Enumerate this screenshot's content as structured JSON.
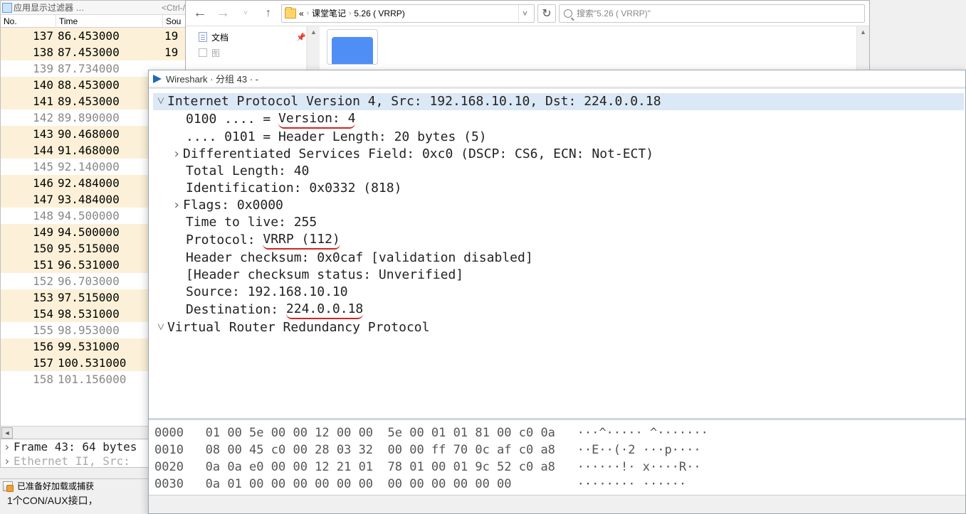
{
  "filter": {
    "label": "应用显示过滤器 …",
    "hint": "<Ctrl-/>"
  },
  "columns": {
    "no": "No.",
    "time": "Time",
    "src": "Sou"
  },
  "packets": [
    {
      "no": "137",
      "time": "86.453000",
      "src": "19",
      "alt": true
    },
    {
      "no": "138",
      "time": "87.453000",
      "src": "19",
      "alt": true
    },
    {
      "no": "139",
      "time": "87.734000",
      "src": "",
      "dim": true
    },
    {
      "no": "140",
      "time": "88.453000",
      "src": "",
      "alt": true
    },
    {
      "no": "141",
      "time": "89.453000",
      "src": "",
      "alt": true
    },
    {
      "no": "142",
      "time": "89.890000",
      "src": "",
      "dim": true
    },
    {
      "no": "143",
      "time": "90.468000",
      "src": "",
      "alt": true
    },
    {
      "no": "144",
      "time": "91.468000",
      "src": "",
      "alt": true
    },
    {
      "no": "145",
      "time": "92.140000",
      "src": "",
      "dim": true
    },
    {
      "no": "146",
      "time": "92.484000",
      "src": "",
      "alt": true
    },
    {
      "no": "147",
      "time": "93.484000",
      "src": "",
      "alt": true
    },
    {
      "no": "148",
      "time": "94.500000",
      "src": "",
      "dim": true
    },
    {
      "no": "149",
      "time": "94.500000",
      "src": "",
      "alt": true
    },
    {
      "no": "150",
      "time": "95.515000",
      "src": "",
      "alt": true
    },
    {
      "no": "151",
      "time": "96.531000",
      "src": "",
      "alt": true
    },
    {
      "no": "152",
      "time": "96.703000",
      "src": "",
      "dim": true
    },
    {
      "no": "153",
      "time": "97.515000",
      "src": "",
      "alt": true
    },
    {
      "no": "154",
      "time": "98.531000",
      "src": "",
      "alt": true
    },
    {
      "no": "155",
      "time": "98.953000",
      "src": "",
      "dim": true
    },
    {
      "no": "156",
      "time": "99.531000",
      "src": "",
      "alt": true
    },
    {
      "no": "157",
      "time": "100.531000",
      "src": "",
      "alt": true
    },
    {
      "no": "158",
      "time": "101.156000",
      "src": "",
      "dim": true
    }
  ],
  "frame_line": "Frame 43: 64 bytes",
  "eth_line": "Ethernet II, Src:",
  "status_text": "已准备好加载或捕获",
  "extra_line": "1个CON/AUX接口，",
  "explorer": {
    "crumbs": [
      "«",
      "课堂笔记",
      "5.26 ( VRRP)"
    ],
    "search_placeholder": "搜索\"5.26 ( VRRP)\"",
    "side_doc": "文档",
    "side_img": "图"
  },
  "ws": {
    "title": "Wireshark · 分组 43 · -",
    "ip_header": "Internet Protocol Version 4, Src: 192.168.10.10, Dst: 224.0.0.18",
    "ver_pre": "0100 .... = ",
    "ver_mid": "Version: 4",
    "hlen": ".... 0101 = Header Length: 20 bytes (5)",
    "dsf": "Differentiated Services Field: 0xc0 (DSCP: CS6, ECN: Not-ECT)",
    "tlen": "Total Length: 40",
    "ident": "Identification: 0x0332 (818)",
    "flags": "Flags: 0x0000",
    "ttl": "Time to live: 255",
    "proto_pre": "Protocol: ",
    "proto_mid": "VRRP (112)",
    "hcks": "Header checksum: 0x0caf [validation disabled]",
    "hcks2": "[Header checksum status: Unverified]",
    "src": "Source: 192.168.10.10",
    "dst_pre": "Destination: ",
    "dst_mid": "224.0.0.18",
    "vrrp": "Virtual Router Redundancy Protocol",
    "hex": [
      "0000   01 00 5e 00 00 12 00 00  5e 00 01 01 81 00 c0 0a   ···^····· ^·······",
      "0010   08 00 45 c0 00 28 03 32  00 00 ff 70 0c af c0 a8   ··E··(·2 ···p····",
      "0020   0a 0a e0 00 00 12 21 01  78 01 00 01 9c 52 c0 a8   ······!· x····R··",
      "0030   0a 01 00 00 00 00 00 00  00 00 00 00 00 00         ········ ······  "
    ]
  }
}
